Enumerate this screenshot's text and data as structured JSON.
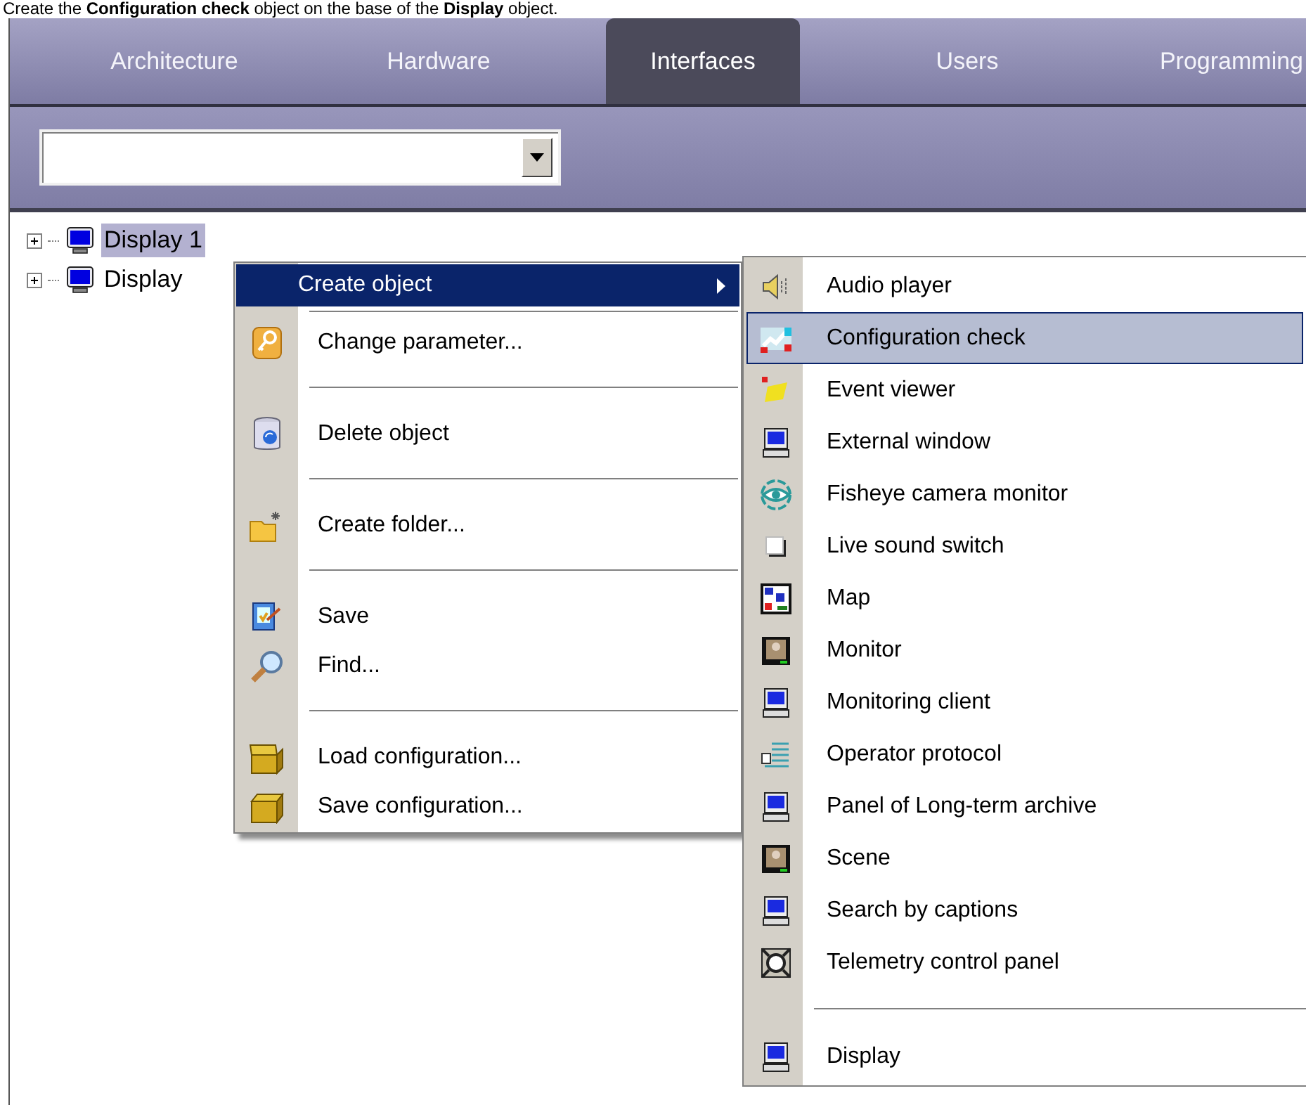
{
  "caption": "Create the **Configuration check** object on the base of the **Display** object.",
  "tabs": [
    {
      "label": "Architecture",
      "selected": false
    },
    {
      "label": "Hardware",
      "selected": false
    },
    {
      "label": "Interfaces",
      "selected": true
    },
    {
      "label": "Users",
      "selected": false
    },
    {
      "label": "Programming",
      "selected": false
    }
  ],
  "tree": [
    {
      "label": "Display 1",
      "selected": true,
      "expanded": false
    },
    {
      "label": "Display",
      "selected": false,
      "expanded": false
    }
  ],
  "context_menu": {
    "groups": [
      {
        "items": [
          {
            "label": "Create object",
            "selected": true,
            "submenu": true
          }
        ]
      },
      {
        "items": [
          {
            "label": "Change parameter...",
            "selected": false,
            "submenu": false
          }
        ]
      },
      {
        "items": [
          {
            "label": "Delete object",
            "selected": false,
            "submenu": false
          }
        ]
      },
      {
        "items": [
          {
            "label": "Create folder...",
            "selected": false,
            "submenu": false
          }
        ]
      },
      {
        "items": [
          {
            "label": "Save",
            "selected": false,
            "submenu": false
          },
          {
            "label": "Find...",
            "selected": false,
            "submenu": false
          }
        ]
      },
      {
        "items": [
          {
            "label": "Load configuration...",
            "selected": false,
            "submenu": false
          },
          {
            "label": "Save configuration...",
            "selected": false,
            "submenu": false
          }
        ]
      }
    ]
  },
  "submenu": {
    "groups": [
      {
        "items": [
          {
            "label": "Audio player",
            "selected": false
          },
          {
            "label": "Configuration check",
            "selected": true
          },
          {
            "label": "Event viewer",
            "selected": false
          },
          {
            "label": "External window",
            "selected": false
          },
          {
            "label": "Fisheye camera monitor",
            "selected": false
          },
          {
            "label": "Live sound switch",
            "selected": false
          },
          {
            "label": "Map",
            "selected": false
          },
          {
            "label": "Monitor",
            "selected": false
          },
          {
            "label": "Monitoring client",
            "selected": false
          },
          {
            "label": "Operator protocol",
            "selected": false
          },
          {
            "label": "Panel of Long-term archive",
            "selected": false
          },
          {
            "label": "Scene",
            "selected": false
          },
          {
            "label": "Search by captions",
            "selected": false
          },
          {
            "label": "Telemetry control panel",
            "selected": false
          }
        ]
      },
      {
        "items": [
          {
            "label": "Display",
            "selected": false
          }
        ]
      }
    ]
  }
}
